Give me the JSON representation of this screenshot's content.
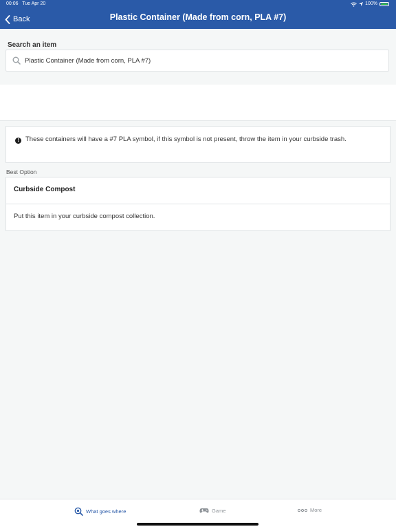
{
  "status_bar": {
    "time": "00:06",
    "date": "Tue Apr 20",
    "battery_percent": "100%"
  },
  "nav": {
    "back_label": "Back",
    "title": "Plastic Container (Made from corn, PLA #7)"
  },
  "search": {
    "label": "Search an item",
    "value": "Plastic Container (Made from corn, PLA #7)"
  },
  "note": {
    "text": "These containers will have a #7 PLA symbol, if this symbol is not present, throw the item in your curbside trash."
  },
  "best_option": {
    "section_label": "Best Option",
    "title": "Curbside Compost",
    "description": "Put this item in your curbside compost collection."
  },
  "tabs": [
    {
      "label": "What goes where",
      "icon": "search-icon",
      "active": true
    },
    {
      "label": "Game",
      "icon": "gamepad-icon",
      "active": false
    },
    {
      "label": "More",
      "icon": "more-icon",
      "active": false
    }
  ],
  "colors": {
    "header_blue": "#2a5aa8",
    "active_tab": "#2a5aa8",
    "inactive_tab": "#8e9398",
    "background": "#f5f7f7"
  }
}
